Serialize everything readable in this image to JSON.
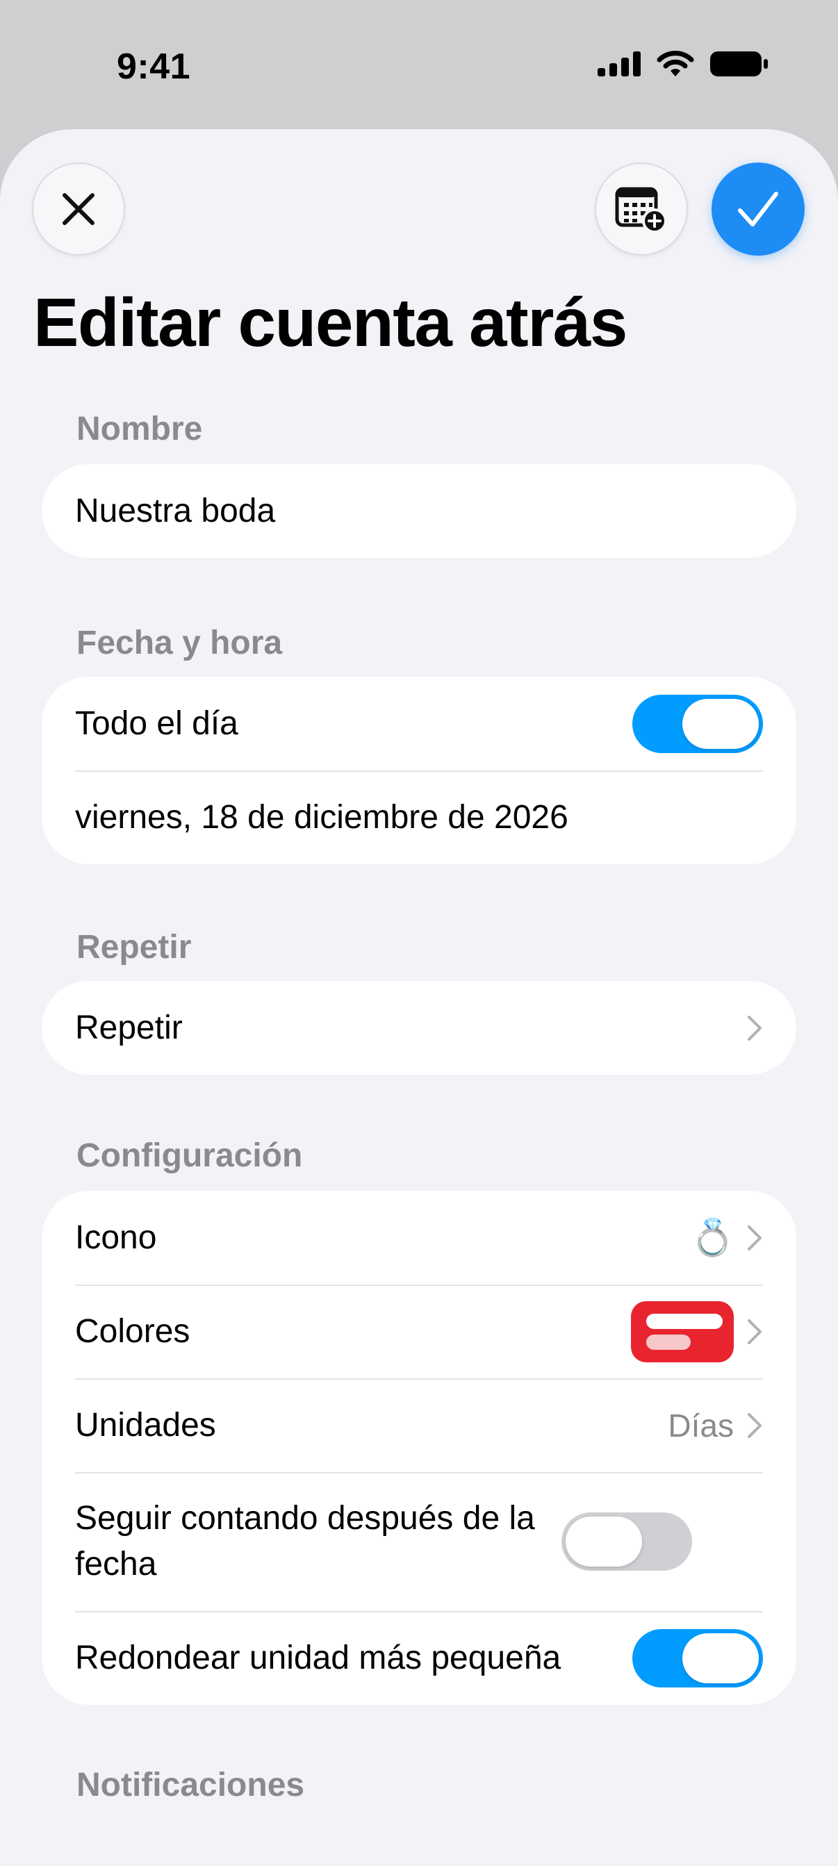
{
  "status_bar": {
    "time": "9:41"
  },
  "header": {
    "title": "Editar cuenta atrás"
  },
  "sections": {
    "name": {
      "label": "Nombre",
      "value": "Nuestra boda"
    },
    "datetime": {
      "label": "Fecha y hora",
      "all_day_label": "Todo el día",
      "all_day_on": true,
      "date_value": "viernes, 18 de diciembre de 2026"
    },
    "repeat": {
      "label": "Repetir",
      "row_label": "Repetir"
    },
    "settings": {
      "label": "Configuración",
      "icon_label": "Icono",
      "icon_value": "💍",
      "colors_label": "Colores",
      "colors_accent": "#e8242f",
      "units_label": "Unidades",
      "units_value": "Días",
      "keep_counting_label": "Seguir contando después de la fecha",
      "keep_counting_on": false,
      "round_label": "Redondear unidad más pequeña",
      "round_on": true
    },
    "notifications": {
      "label": "Notificaciones"
    }
  },
  "colors": {
    "accent": "#009cff",
    "confirm": "#1e8cf5",
    "background": "#f2f2f7"
  }
}
